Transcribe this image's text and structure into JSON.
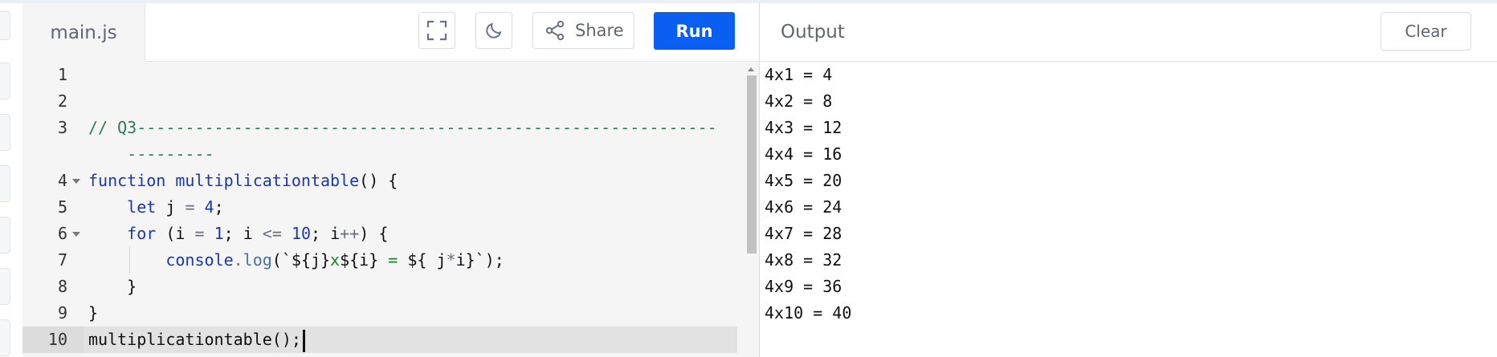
{
  "editor": {
    "file_tab": "main.js",
    "buttons": {
      "fullscreen_icon": "expand-icon",
      "theme_icon": "moon-icon",
      "share_label": "Share",
      "share_icon": "share-icon",
      "run_label": "Run"
    },
    "line_numbers": [
      "1",
      "2",
      "3",
      "",
      "4",
      "5",
      "6",
      "7",
      "8",
      "9",
      "10"
    ],
    "code": {
      "l3a": "// Q3------------------------------------------------------------",
      "l3b": "    ---------",
      "l4_kw": "function",
      "l4_fn": "multiplicationtable",
      "l4_rest": "() {",
      "l5_kw": "let",
      "l5_var": "j",
      "l5_op": "=",
      "l5_num": "4",
      "l5_end": ";",
      "l6_kw": "for",
      "l6_a": "(i",
      "l6_op1": "=",
      "l6_num1": "1",
      "l6_b": "; i",
      "l6_op2": "<=",
      "l6_num2": "10",
      "l6_c": "; i",
      "l6_op3": "++",
      "l6_d": ") {",
      "l7_obj": "console",
      "l7_dot": ".",
      "l7_prop": "log",
      "l7_a": "(`${j}",
      "l7_x": "x",
      "l7_b": "${i}",
      "l7_eq": " = ",
      "l7_c": "${ j",
      "l7_star": "*",
      "l7_d": "i}`);",
      "l8": "}",
      "l9": "}",
      "l10": "multiplicationtable();"
    }
  },
  "output": {
    "title": "Output",
    "clear_label": "Clear",
    "lines": [
      "4x1 = 4",
      "4x2 = 8",
      "4x3 = 12",
      "4x4 = 16",
      "4x5 = 20",
      "4x6 = 24",
      "4x7 = 28",
      "4x8 = 32",
      "4x9 = 36",
      "4x10 = 40"
    ]
  },
  "colors": {
    "run_button": "#0b5ff0",
    "comment": "#2e7d55",
    "keyword": "#1a36b4",
    "editor_bg": "#f5f5f5"
  }
}
